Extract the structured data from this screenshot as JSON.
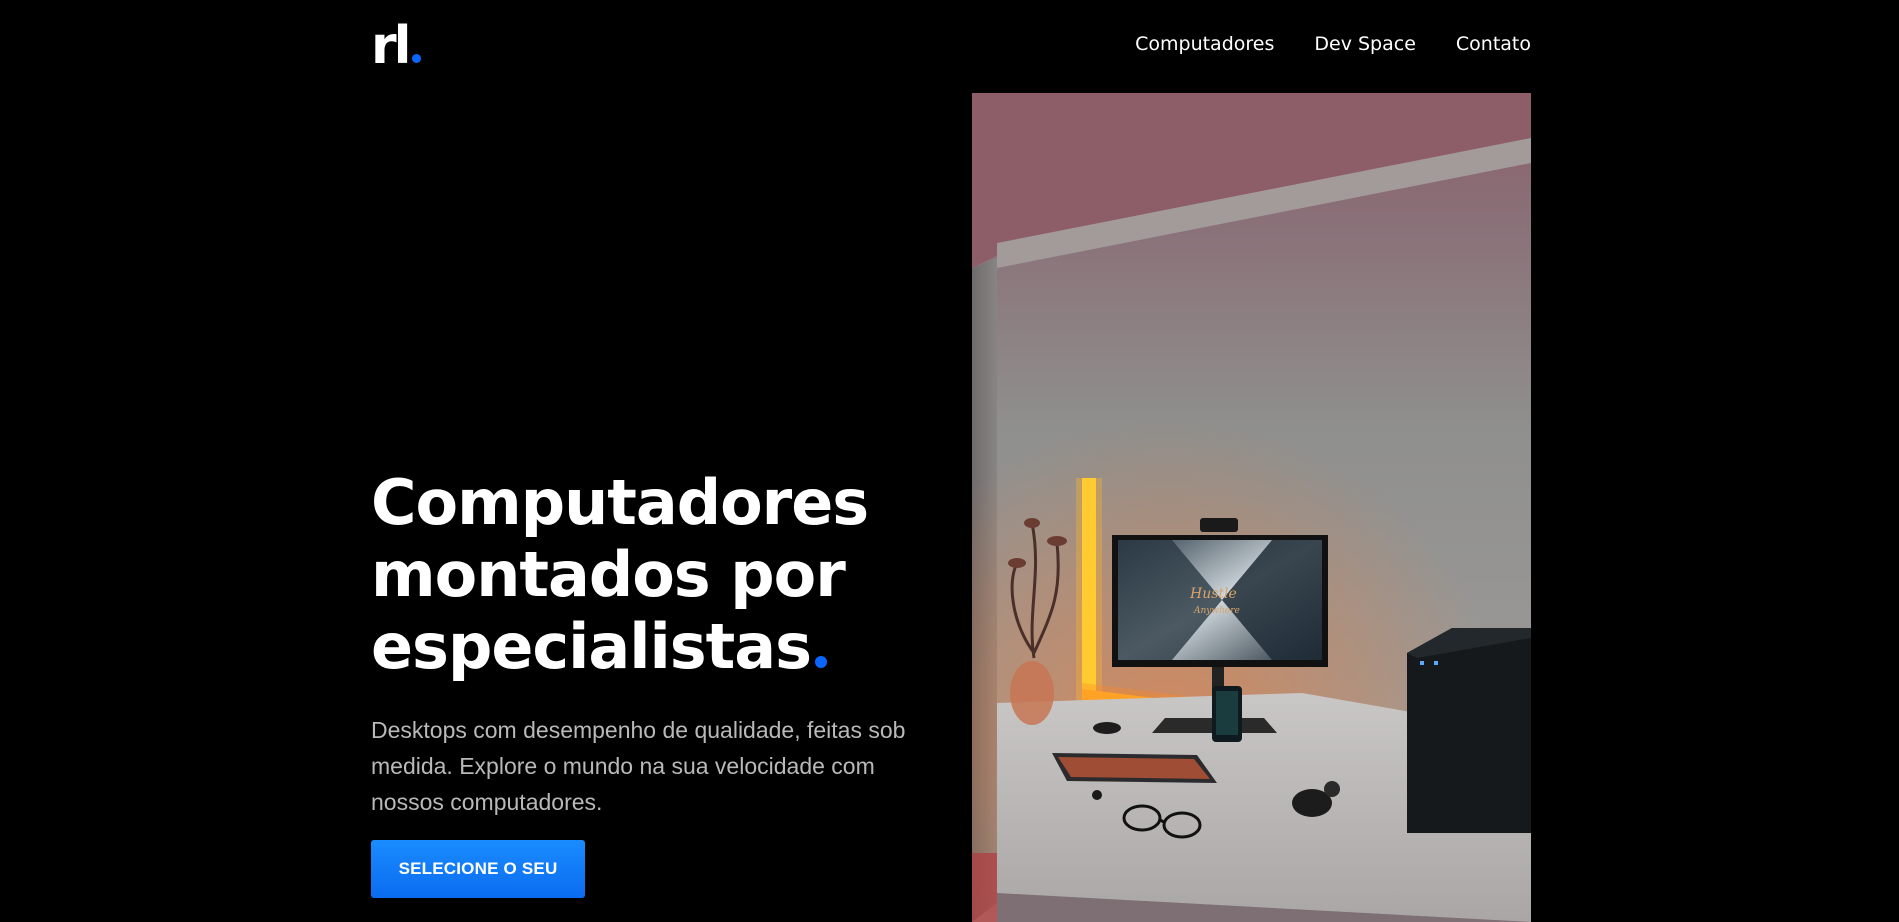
{
  "header": {
    "logo_text": "rl",
    "nav": [
      {
        "label": "Computadores"
      },
      {
        "label": "Dev Space"
      },
      {
        "label": "Contato"
      }
    ]
  },
  "hero": {
    "title_lines": [
      "Computadores",
      "montados por",
      "especialistas"
    ],
    "description": "Desktops com desempenho de qualidade, feitas sob medida. Explore o mundo na sua velocidade com nossos computadores.",
    "cta_label": "SELECIONE O SEU"
  },
  "photo": {
    "monitor_text": "Hustle",
    "monitor_subtext": "Anywhere"
  },
  "colors": {
    "background": "#000000",
    "accent": "#0a66ff",
    "button": "#1a8cff",
    "text": "#ffffff",
    "muted_text": "#b9b9b9"
  }
}
